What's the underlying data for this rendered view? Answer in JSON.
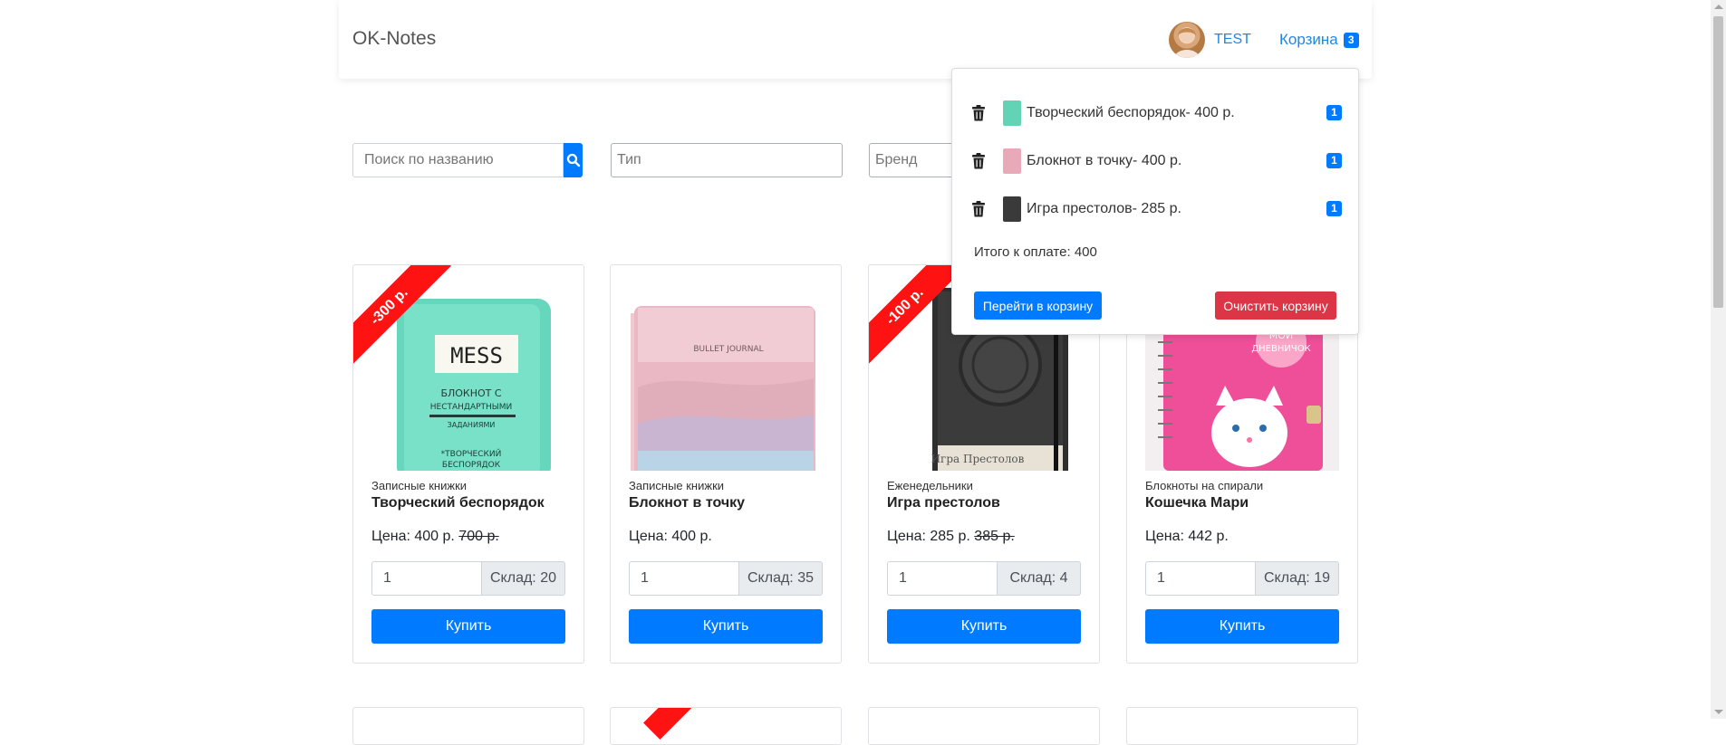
{
  "navbar": {
    "brand": "OK-Notes",
    "user_name": "TEST",
    "cart_label": "Корзина",
    "cart_count": "3"
  },
  "filters": {
    "search_placeholder": "Поиск по названию",
    "type_placeholder": "Тип",
    "brand_placeholder": "Бренд"
  },
  "products": [
    {
      "category": "Записные книжки",
      "title": "Творческий беспорядок",
      "price": "Цена: 400 р.",
      "old_price": "700 р.",
      "discount": "-300 р.",
      "qty": "1",
      "stock": "Склад: 20",
      "buy": "Купить"
    },
    {
      "category": "Записные книжки",
      "title": "Блокнот в точку",
      "price": "Цена: 400 р.",
      "old_price": "",
      "discount": "",
      "qty": "1",
      "stock": "Склад: 35",
      "buy": "Купить"
    },
    {
      "category": "Еженедельники",
      "title": "Игра престолов",
      "price": "Цена: 285 р.",
      "old_price": "385 р.",
      "discount": "-100 р.",
      "qty": "1",
      "stock": "Склад: 4",
      "buy": "Купить"
    },
    {
      "category": "Блокноты на спирали",
      "title": "Кошечка Мари",
      "price": "Цена: 442 р.",
      "old_price": "",
      "discount": "",
      "qty": "1",
      "stock": "Склад: 19",
      "buy": "Купить"
    }
  ],
  "cart": {
    "items": [
      {
        "text": "Творческий беспорядок- 400 р.",
        "count": "1",
        "thumb_color": "#63d3b6"
      },
      {
        "text": "Блокнот в точку- 400 р.",
        "count": "1",
        "thumb_color": "#e8a9b8"
      },
      {
        "text": "Игра престолов- 285 р.",
        "count": "1",
        "thumb_color": "#3a3a3a"
      }
    ],
    "total": "Итого к оплате: 400",
    "go_button": "Перейти в корзину",
    "clear_button": "Очистить корзину"
  },
  "colors": {
    "primary": "#007bff",
    "danger": "#dc3545",
    "ribbon": "#ff1212"
  },
  "icons": [
    "search-icon",
    "trash-icon"
  ]
}
